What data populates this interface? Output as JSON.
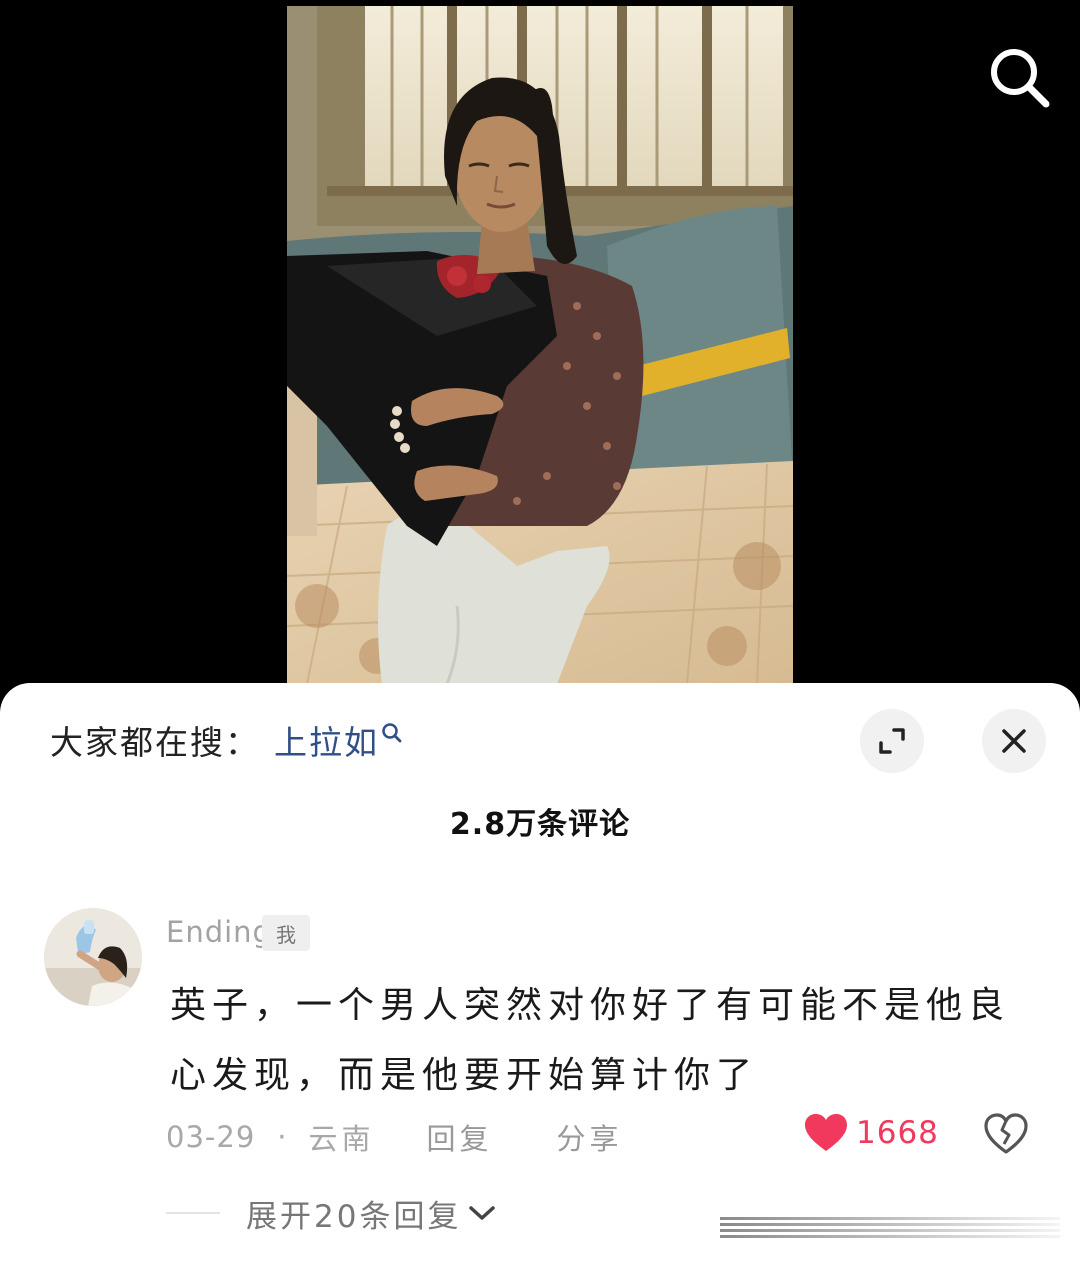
{
  "video": {
    "search_icon": "search-icon"
  },
  "sheet": {
    "trending_label": "大家都在搜：",
    "trending_query": "上拉如",
    "expand_icon": "expand-icon",
    "close_icon": "close-icon",
    "comment_count": "2.8万条评论"
  },
  "comment": {
    "username": "Ending",
    "user_badge": "我",
    "text": "英子，一个男人突然对你好了有可能不是他良心发现，而是他要开始算计你了",
    "date": "03-29",
    "separator": "·",
    "location": "云南",
    "reply_label": "回复",
    "share_label": "分享",
    "likes": "1668",
    "like_icon": "heart-icon",
    "dislike_icon": "broken-heart-icon",
    "expand_replies": "展开20条回复"
  },
  "colors": {
    "like": "#f0395c",
    "link": "#2f4f86",
    "muted": "#a8a8a8"
  }
}
